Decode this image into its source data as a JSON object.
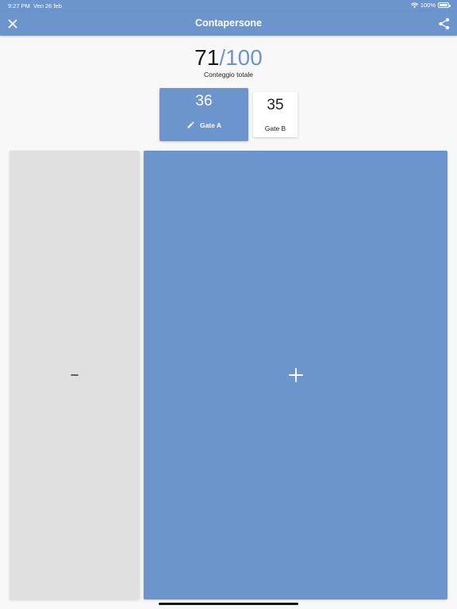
{
  "status_bar": {
    "time": "9:27 PM",
    "date": "Ven 26 feb",
    "battery": "100%",
    "icons": [
      "wifi-icon",
      "battery-icon"
    ]
  },
  "app_bar": {
    "title": "Contapersone",
    "left_icon": "close-icon",
    "right_icon": "share-icon"
  },
  "total": {
    "current": "71",
    "separator": "/",
    "max": "100",
    "label": "Conteggio totale"
  },
  "gates": [
    {
      "count": "36",
      "name": "Gate A",
      "selected": true,
      "icon": "pencil-icon"
    },
    {
      "count": "35",
      "name": "Gate B",
      "selected": false
    }
  ],
  "controls": {
    "decrement_icon": "minus-icon",
    "increment_icon": "plus-icon"
  },
  "colors": {
    "accent": "#6d95cd",
    "decrement_bg": "#e0e0e0",
    "background": "#f8f8f8"
  }
}
